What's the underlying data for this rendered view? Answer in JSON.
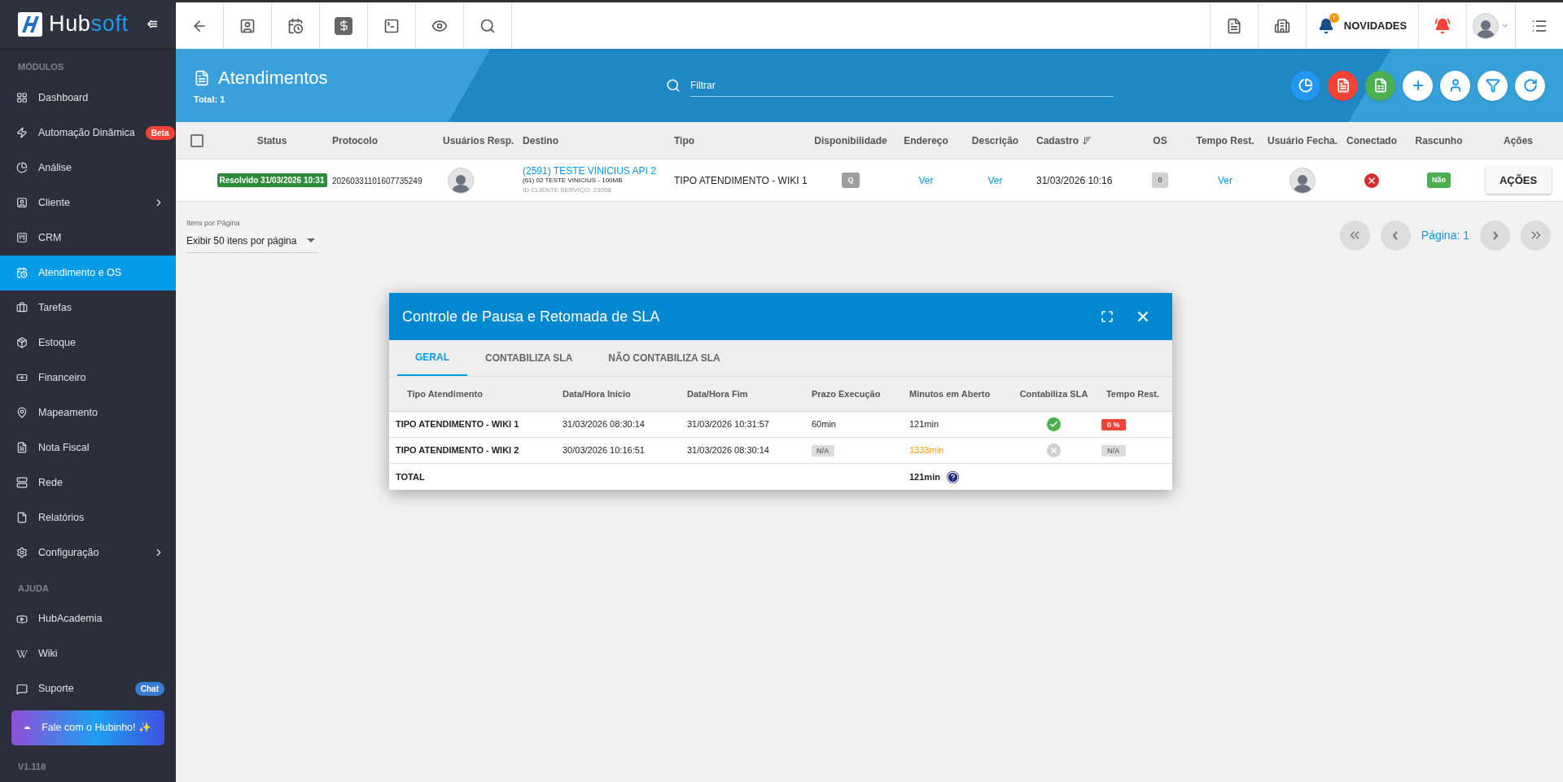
{
  "sidebar": {
    "brand": [
      "Hub",
      "soft"
    ],
    "sections": [
      {
        "heading": "MÓDULOS",
        "items": [
          {
            "label": "Dashboard",
            "selected": false,
            "submenu": false
          },
          {
            "label": "Automação Dinâmica",
            "selected": false,
            "submenu": false,
            "badge": {
              "text": "Beta",
              "color": "#f44336"
            }
          },
          {
            "label": "Análise",
            "selected": false,
            "submenu": false
          },
          {
            "label": "Cliente",
            "selected": false,
            "submenu": true
          },
          {
            "label": "CRM",
            "selected": false,
            "submenu": false
          },
          {
            "label": "Atendimento e OS",
            "selected": true,
            "submenu": false
          },
          {
            "label": "Tarefas",
            "selected": false,
            "submenu": false
          },
          {
            "label": "Estoque",
            "selected": false,
            "submenu": false
          },
          {
            "label": "Financeiro",
            "selected": false,
            "submenu": false
          },
          {
            "label": "Mapeamento",
            "selected": false,
            "submenu": false
          },
          {
            "label": "Nota Fiscal",
            "selected": false,
            "submenu": false
          },
          {
            "label": "Rede",
            "selected": false,
            "submenu": false
          },
          {
            "label": "Relatórios",
            "selected": false,
            "submenu": false
          },
          {
            "label": "Configuração",
            "selected": false,
            "submenu": true
          }
        ]
      },
      {
        "heading": "AJUDA",
        "items": [
          {
            "label": "HubAcademia",
            "selected": false,
            "submenu": false
          },
          {
            "label": "Wiki",
            "selected": false,
            "submenu": false
          },
          {
            "label": "Suporte",
            "selected": false,
            "submenu": false,
            "badge": {
              "text": "Chat",
              "color": "#3a7bd5"
            }
          }
        ]
      }
    ],
    "assistant_button": "Fale com o Hubinho! ✨",
    "version": "V1.118"
  },
  "topbar": {
    "news_badge": "!",
    "news_label": "NOVIDADES"
  },
  "header": {
    "title": "Atendimentos",
    "total": "Total: 1",
    "filter": {
      "placeholder": "Filtrar"
    }
  },
  "table": {
    "select_all": {
      "checked": false
    },
    "columns": [
      "Status",
      "Protocolo",
      "Usuários Resp.",
      "Destino",
      "Tipo",
      "Disponibilidade",
      "Endereço",
      "Descrição",
      "Cadastro",
      "OS",
      "Tempo Rest.",
      "Usuário Fecha.",
      "Conectado",
      "Rascunho",
      "Ações"
    ],
    "rows": [
      {
        "status": "Resolvido 31/03/2026 10:31",
        "protocolo": "20260331101607735249",
        "destino": {
          "link": "(2591) TESTE VINICIUS API 2",
          "plan": "(61) 02 TESTE VINICIUS - 100MB",
          "service_id": "ID CLIENTE SERVIÇO: 23058"
        },
        "tipo": "TIPO ATENDIMENTO - WIKI 1",
        "disponibilidade": "Q",
        "endereco": "Ver",
        "descricao": "Ver",
        "cadastro": "31/03/2026 10:16",
        "os": "0",
        "tempo_rest": "Ver",
        "conectado": false,
        "rascunho": "Não",
        "acoes": "AÇÕES"
      }
    ]
  },
  "pagination": {
    "per_page_label": "Itens por Página",
    "per_page_value": "Exibir 50 itens por página",
    "page": "Página: 1"
  },
  "dialog": {
    "title": "Controle de Pausa e Retomada de SLA",
    "tabs": [
      {
        "label": "GERAL",
        "selected": true
      },
      {
        "label": "CONTABILIZA SLA",
        "selected": false
      },
      {
        "label": "NÃO CONTABILIZA SLA",
        "selected": false
      }
    ],
    "columns": [
      "Tipo Atendimento",
      "Data/Hora Início",
      "Data/Hora Fim",
      "Prazo Execução",
      "Minutos em Aberto",
      "Contabiliza SLA",
      "Tempo Rest."
    ],
    "rows": [
      {
        "tipo": "TIPO ATENDIMENTO - WIKI 1",
        "inicio": "31/03/2026 08:30:14",
        "fim": "31/03/2026 10:31:57",
        "prazo": {
          "text": "60min",
          "kind": "text"
        },
        "minutos": {
          "text": "121min",
          "overdue": false
        },
        "contabiliza": true,
        "tempo_rest": {
          "text": "0 %",
          "kind": "danger"
        }
      },
      {
        "tipo": "TIPO ATENDIMENTO - WIKI 2",
        "inicio": "30/03/2026 10:16:51",
        "fim": "31/03/2026 08:30:14",
        "prazo": {
          "text": "N/A",
          "kind": "muted"
        },
        "minutos": {
          "text": "1333min",
          "overdue": true
        },
        "contabiliza": false,
        "tempo_rest": {
          "text": "N/A",
          "kind": "muted"
        }
      }
    ],
    "total": {
      "label": "TOTAL",
      "value": "121min"
    }
  }
}
